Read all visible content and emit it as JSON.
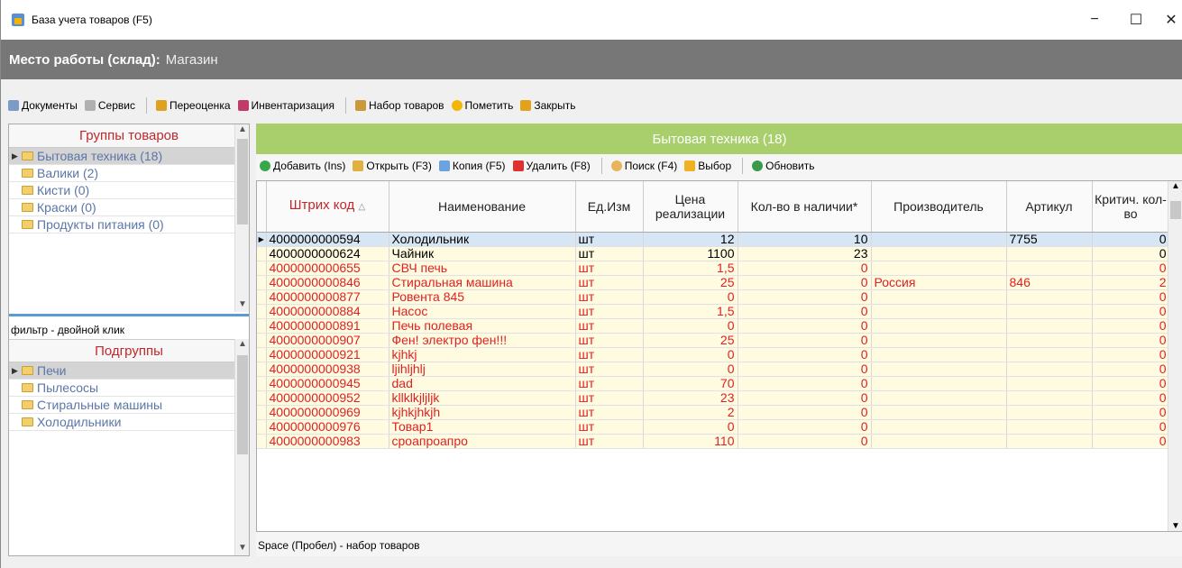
{
  "window": {
    "title": "База учета товаров (F5)",
    "minimize": "−",
    "maximize": "☐",
    "close": "✕"
  },
  "workplace": {
    "label": "Место работы (склад):",
    "value": "Магазин"
  },
  "toolbar": {
    "documents": "Документы",
    "service": "Сервис",
    "revaluation": "Переоценка",
    "inventory": "Инвентаризация",
    "goods_set": "Набор товаров",
    "mark": "Пометить",
    "close": "Закрыть"
  },
  "groups": {
    "header": "Группы товаров",
    "items": [
      "Бытовая техника (18)",
      "Валики (2)",
      "Кисти (0)",
      "Краски (0)",
      "Продукты питания (0)"
    ]
  },
  "filter_hint": "фильтр - двойной клик",
  "subgroups": {
    "header": "Подгруппы",
    "items": [
      "Печи",
      "Пылесосы",
      "Стиральные машины",
      "Холодильники"
    ]
  },
  "category_title": "Бытовая техника (18)",
  "actions": {
    "add": "Добавить (Ins)",
    "open": "Открыть (F3)",
    "copy": "Копия (F5)",
    "delete": "Удалить (F8)",
    "search": "Поиск (F4)",
    "select": "Выбор",
    "refresh": "Обновить"
  },
  "table": {
    "headers": {
      "barcode": "Штрих код",
      "sort_marker": "△",
      "name": "Наименование",
      "unit": "Ед.Изм",
      "price": "Цена реализации",
      "qty": "Кол-во в наличии*",
      "maker": "Производитель",
      "article": "Артикул",
      "critical": "Критич. кол-во"
    },
    "rows": [
      {
        "barcode": "4000000000594",
        "name": "Холодильник",
        "unit": "шт",
        "price": "12",
        "qty": "10",
        "maker": "",
        "article": "7755",
        "critical": "0"
      },
      {
        "barcode": "4000000000624",
        "name": "Чайник",
        "unit": "шт",
        "price": "1100",
        "qty": "23",
        "maker": "",
        "article": "",
        "critical": "0"
      },
      {
        "barcode": "4000000000655",
        "name": "СВЧ печь",
        "unit": "шт",
        "price": "1,5",
        "qty": "0",
        "maker": "",
        "article": "",
        "critical": "0"
      },
      {
        "barcode": "4000000000846",
        "name": "Стиральная машина",
        "unit": "шт",
        "price": "25",
        "qty": "0",
        "maker": "Россия",
        "article": "846",
        "critical": "2"
      },
      {
        "barcode": "4000000000877",
        "name": "Ровента 845",
        "unit": "шт",
        "price": "0",
        "qty": "0",
        "maker": "",
        "article": "",
        "critical": "0"
      },
      {
        "barcode": "4000000000884",
        "name": "Насос",
        "unit": "шт",
        "price": "1,5",
        "qty": "0",
        "maker": "",
        "article": "",
        "critical": "0"
      },
      {
        "barcode": "4000000000891",
        "name": "Печь полевая",
        "unit": "шт",
        "price": "0",
        "qty": "0",
        "maker": "",
        "article": "",
        "critical": "0"
      },
      {
        "barcode": "4000000000907",
        "name": "Фен! электро фен!!!",
        "unit": "шт",
        "price": "25",
        "qty": "0",
        "maker": "",
        "article": "",
        "critical": "0"
      },
      {
        "barcode": "4000000000921",
        "name": "kjhkj",
        "unit": "шт",
        "price": "0",
        "qty": "0",
        "maker": "",
        "article": "",
        "critical": "0"
      },
      {
        "barcode": "4000000000938",
        "name": "ljihljhlj",
        "unit": "шт",
        "price": "0",
        "qty": "0",
        "maker": "",
        "article": "",
        "critical": "0"
      },
      {
        "barcode": "4000000000945",
        "name": "dad",
        "unit": "шт",
        "price": "70",
        "qty": "0",
        "maker": "",
        "article": "",
        "critical": "0"
      },
      {
        "barcode": "4000000000952",
        "name": "kllklkjljljk",
        "unit": "шт",
        "price": "23",
        "qty": "0",
        "maker": "",
        "article": "",
        "critical": "0"
      },
      {
        "barcode": "4000000000969",
        "name": "kjhkjhkjh",
        "unit": "шт",
        "price": "2",
        "qty": "0",
        "maker": "",
        "article": "",
        "critical": "0"
      },
      {
        "barcode": "4000000000976",
        "name": "Товар1",
        "unit": "шт",
        "price": "0",
        "qty": "0",
        "maker": "",
        "article": "",
        "critical": "0"
      },
      {
        "barcode": "4000000000983",
        "name": "сроапроапро",
        "unit": "шт",
        "price": "110",
        "qty": "0",
        "maker": "",
        "article": "",
        "critical": "0"
      }
    ]
  },
  "status_text": "Space (Пробел) - набор товаров",
  "colors": {
    "accent_green": "#a9cf6d",
    "workplace_bar": "#777777",
    "red_text": "#d22222",
    "selected_row": "#d7e6f5"
  }
}
